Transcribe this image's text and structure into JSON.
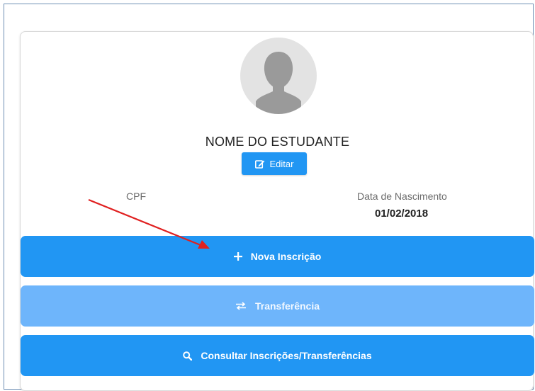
{
  "student": {
    "name": "NOME DO ESTUDANTE",
    "cpf_label": "CPF",
    "dob_label": "Data de Nascimento",
    "dob_value": "01/02/2018"
  },
  "buttons": {
    "edit": "Editar",
    "new_enrollment": "Nova Inscrição",
    "transfer": "Transferência",
    "query": "Consultar Inscrições/Transferências"
  },
  "colors": {
    "primary": "#2196f3",
    "primary_light": "#6eb5fb",
    "annotation_arrow": "#e02020"
  },
  "icons": {
    "avatar": "user-silhouette-icon",
    "edit": "edit-icon",
    "new_enrollment": "plus-icon",
    "transfer": "exchange-icon",
    "query": "search-icon"
  }
}
